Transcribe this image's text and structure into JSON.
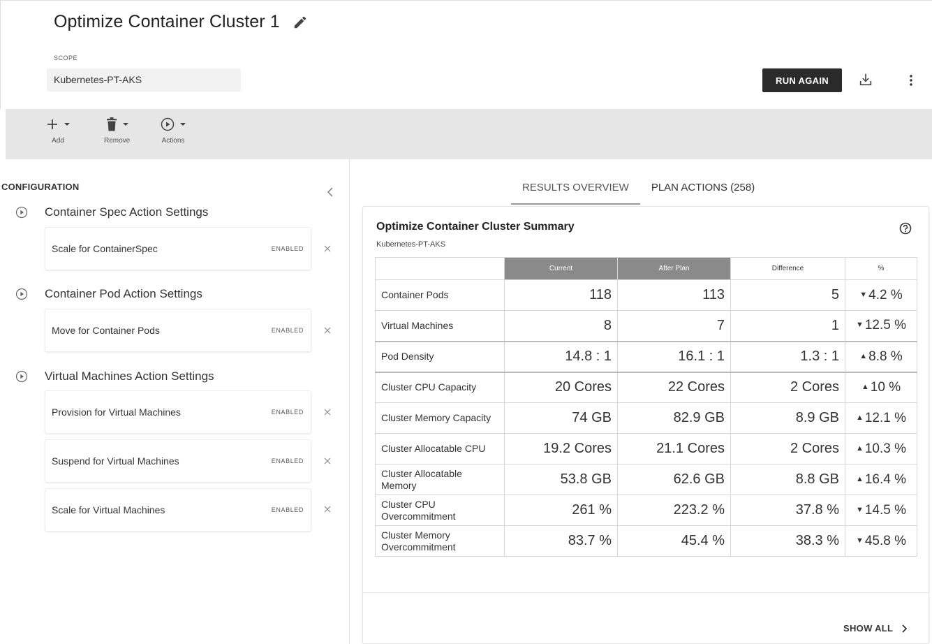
{
  "header": {
    "title": "Optimize Container Cluster 1",
    "scope_label": "SCOPE",
    "scope_value": "Kubernetes-PT-AKS",
    "run_again_label": "RUN AGAIN"
  },
  "toolbar": {
    "add_label": "Add",
    "remove_label": "Remove",
    "actions_label": "Actions"
  },
  "configuration": {
    "title": "CONFIGURATION",
    "groups": [
      {
        "label": "Container Spec Action Settings",
        "settings": [
          {
            "label": "Scale for ContainerSpec",
            "status": "ENABLED"
          }
        ]
      },
      {
        "label": "Container Pod Action Settings",
        "settings": [
          {
            "label": "Move for Container Pods",
            "status": "ENABLED"
          }
        ]
      },
      {
        "label": "Virtual Machines Action Settings",
        "settings": [
          {
            "label": "Provision for Virtual Machines",
            "status": "ENABLED"
          },
          {
            "label": "Suspend for Virtual Machines",
            "status": "ENABLED"
          },
          {
            "label": "Scale for Virtual Machines",
            "status": "ENABLED"
          }
        ]
      }
    ]
  },
  "tabs": {
    "results_overview": "RESULTS OVERVIEW",
    "plan_actions": "PLAN ACTIONS (258)"
  },
  "summary": {
    "title": "Optimize Container Cluster Summary",
    "subtitle": "Kubernetes-PT-AKS",
    "columns": [
      "Current",
      "After Plan",
      "Difference",
      "%"
    ],
    "rows": [
      {
        "metric": "Container Pods",
        "current": "118",
        "after": "113",
        "difference": "5",
        "direction": "down",
        "percent": "4.2 %"
      },
      {
        "metric": "Virtual Machines",
        "current": "8",
        "after": "7",
        "difference": "1",
        "direction": "down",
        "percent": "12.5 %"
      },
      {
        "metric": "Pod Density",
        "current": "14.8 : 1",
        "after": "16.1 : 1",
        "difference": "1.3 : 1",
        "direction": "up",
        "percent": "8.8 %"
      },
      {
        "metric": "Cluster CPU Capacity",
        "current": "20 Cores",
        "after": "22 Cores",
        "difference": "2 Cores",
        "direction": "up",
        "percent": "10 %"
      },
      {
        "metric": "Cluster Memory Capacity",
        "current": "74 GB",
        "after": "82.9 GB",
        "difference": "8.9 GB",
        "direction": "up",
        "percent": "12.1 %"
      },
      {
        "metric": "Cluster Allocatable CPU",
        "current": "19.2 Cores",
        "after": "21.1 Cores",
        "difference": "2 Cores",
        "direction": "up",
        "percent": "10.3 %"
      },
      {
        "metric": "Cluster Allocatable Memory",
        "current": "53.8 GB",
        "after": "62.6 GB",
        "difference": "8.8 GB",
        "direction": "up",
        "percent": "16.4 %"
      },
      {
        "metric": "Cluster CPU Overcommitment",
        "current": "261 %",
        "after": "223.2 %",
        "difference": "37.8 %",
        "direction": "down",
        "percent": "14.5 %"
      },
      {
        "metric": "Cluster Memory Overcommitment",
        "current": "83.7 %",
        "after": "45.4 %",
        "difference": "38.3 %",
        "direction": "down",
        "percent": "45.8 %"
      }
    ],
    "show_all_label": "SHOW ALL"
  },
  "icons": {
    "edit": "pencil-icon",
    "download": "download-icon",
    "more": "kebab-icon",
    "add": "plus-icon",
    "remove": "trash-icon",
    "actions": "play-circle-icon",
    "collapse": "chevron-left-icon",
    "help": "help-circle-icon",
    "remove_setting": "close-icon"
  }
}
